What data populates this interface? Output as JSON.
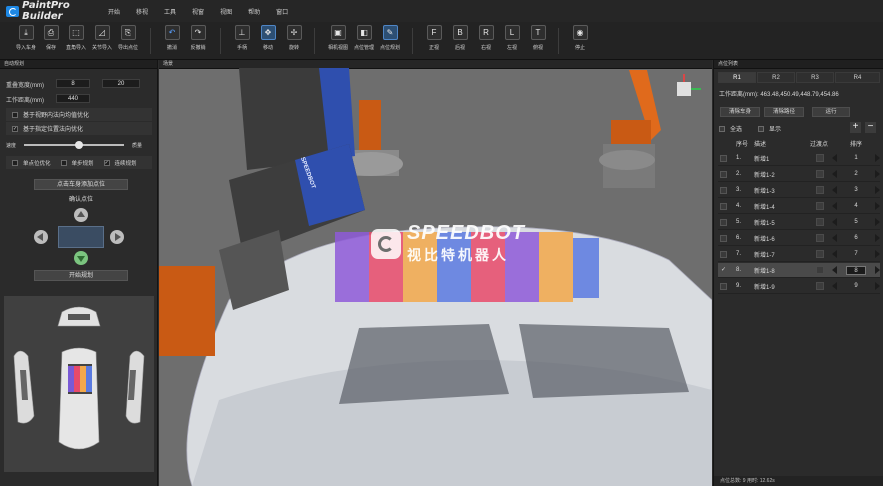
{
  "app": {
    "name": "PaintPro Builder"
  },
  "menu": [
    "开始",
    "移视",
    "工具",
    "视窗",
    "视图",
    "帮助",
    "窗口"
  ],
  "toolbar": {
    "buttons": [
      {
        "id": "import-body",
        "label": "导入车身",
        "icon": "⤓"
      },
      {
        "id": "save",
        "label": "保存",
        "icon": "⎙"
      },
      {
        "id": "vertex-import",
        "label": "直角导入",
        "icon": "⬚"
      },
      {
        "id": "joint-import",
        "label": "关节导入",
        "icon": "◿"
      },
      {
        "id": "export-points",
        "label": "导出点位",
        "icon": "⎘"
      },
      {
        "id": "undo",
        "label": "撤消",
        "icon": "↶"
      },
      {
        "id": "redo",
        "label": "反撤销",
        "icon": "↷"
      },
      {
        "id": "manual",
        "label": "手柄",
        "icon": "⊥"
      },
      {
        "id": "move",
        "label": "移动",
        "icon": "✥"
      },
      {
        "id": "rotate",
        "label": "旋转",
        "icon": "✢"
      },
      {
        "id": "camera-view",
        "label": "相机视图",
        "icon": "▣"
      },
      {
        "id": "point-manage",
        "label": "点位管理",
        "icon": "◧"
      },
      {
        "id": "point-plan",
        "label": "点位规划",
        "icon": "✎"
      },
      {
        "id": "front-view",
        "label": "正视",
        "icon": "F"
      },
      {
        "id": "back-view",
        "label": "后视",
        "icon": "B"
      },
      {
        "id": "right-view",
        "label": "右视",
        "icon": "R"
      },
      {
        "id": "left-view",
        "label": "左视",
        "icon": "L"
      },
      {
        "id": "top-view",
        "label": "俯视",
        "icon": "T"
      },
      {
        "id": "stop",
        "label": "停止",
        "icon": "◉"
      }
    ]
  },
  "left": {
    "header": "自动规划",
    "overlap_label": "重叠宽度(mm)",
    "overlap_a": "8",
    "overlap_b": "20",
    "work_dist_label": "工作距离(mm)",
    "work_dist_value": "440",
    "opt1": "基于视野内法向均值优化",
    "opt2": "基于指定位置法向优化",
    "slider_left": "速度",
    "slider_right": "质量",
    "chk_single": "单点位优化",
    "chk_step": "单步规划",
    "chk_continuous": "连续规划",
    "add_point_btn": "点击车身添加点位",
    "confirm_btn": "确认点位",
    "start_btn": "开始规划",
    "slider_level": 0.55
  },
  "viewport": {
    "header": "场景",
    "robot_label": "SPEEDBOT",
    "watermark_en": "SPEEDBOT",
    "watermark_cn": "视比特机器人"
  },
  "right": {
    "header": "点位列表",
    "tabs": [
      "R1",
      "R2",
      "R3",
      "R4"
    ],
    "work_dist": "工作距离(mm): 463.48,450.49,448.79,454.86",
    "btn_clear_body": "清除车身",
    "btn_clear_path": "清除路径",
    "btn_run": "运行",
    "select_all": "全选",
    "display": "显示",
    "col_seq": "序号",
    "col_desc": "描述",
    "col_transit": "过渡点",
    "col_order": "排序",
    "rows": [
      {
        "seq": "1.",
        "name": "新增1",
        "order": "1",
        "checked": false
      },
      {
        "seq": "2.",
        "name": "新增1-2",
        "order": "2",
        "checked": false
      },
      {
        "seq": "3.",
        "name": "新增1-3",
        "order": "3",
        "checked": false
      },
      {
        "seq": "4.",
        "name": "新增1-4",
        "order": "4",
        "checked": false
      },
      {
        "seq": "5.",
        "name": "新增1-5",
        "order": "5",
        "checked": false
      },
      {
        "seq": "6.",
        "name": "新增1-6",
        "order": "6",
        "checked": false
      },
      {
        "seq": "7.",
        "name": "新增1-7",
        "order": "7",
        "checked": false
      },
      {
        "seq": "8.",
        "name": "新增1-8",
        "order": "8",
        "checked": true
      },
      {
        "seq": "9.",
        "name": "新增1-9",
        "order": "9",
        "checked": false
      }
    ],
    "status": "点位总数: 9   用时: 12.62s"
  }
}
